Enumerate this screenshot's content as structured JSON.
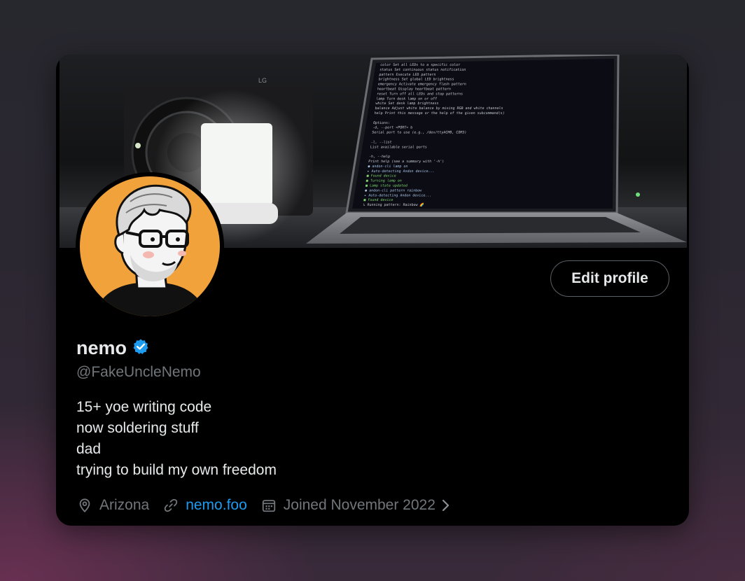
{
  "profile": {
    "name": "nemo",
    "handle": "@FakeUncleNemo",
    "verified": true,
    "bio": [
      "15+ yoe writing code",
      "now soldering stuff",
      "dad",
      "trying to build my own freedom"
    ],
    "location": "Arizona",
    "website": "nemo.foo",
    "joined": "Joined November 2022"
  },
  "actions": {
    "edit_profile_label": "Edit profile"
  },
  "banner": {
    "speaker_brand": "LG",
    "terminal_lines": [
      "color       Set all LEDs to a specific color",
      "status      Set continuous status notification",
      "pattern     Execute LED pattern",
      "brightness  Set global LED brightness",
      "emergency   Activate emergency flash pattern",
      "heartbeat   Display heartbeat pattern",
      "reset       Turn off all LEDs and stop patterns",
      "lamp        Turn desk lamp on or off",
      "white       Set desk lamp brightness",
      "balance     Adjust white balance by mixing RGB and white channels",
      "help        Print this message or the help of the given subcommand(s)",
      "",
      "Options:",
      "  -d, --port <PORT>                                        b",
      "          Serial port to use (e.g., /dev/ttyACM0, COM3)",
      "",
      "  -l, --list",
      "          List available serial ports",
      "",
      "  -h, --help",
      "          Print help (see a summary with '-h')",
      "● andon-cli lamp on",
      "▸ Auto-detecting Andon device...",
      "■ Found device",
      "■ Turning lamp on",
      "■ Lamp state updated",
      "● andon-cli pattern rainbow",
      "▸ Auto-detecting Andon device...",
      "■ Found device",
      "↳ Running pattern: Rainbow 🌈"
    ]
  },
  "colors": {
    "background": "#000000",
    "text_primary": "#e7e9ea",
    "text_secondary": "#71767b",
    "link": "#1d9bf0",
    "verified_badge": "#1d9bf0",
    "avatar_bg": "#f2a23a"
  },
  "icons": {
    "verified": "verified-badge-icon",
    "location": "location-pin-icon",
    "website": "link-icon",
    "joined": "calendar-icon",
    "more": "chevron-right-icon"
  }
}
